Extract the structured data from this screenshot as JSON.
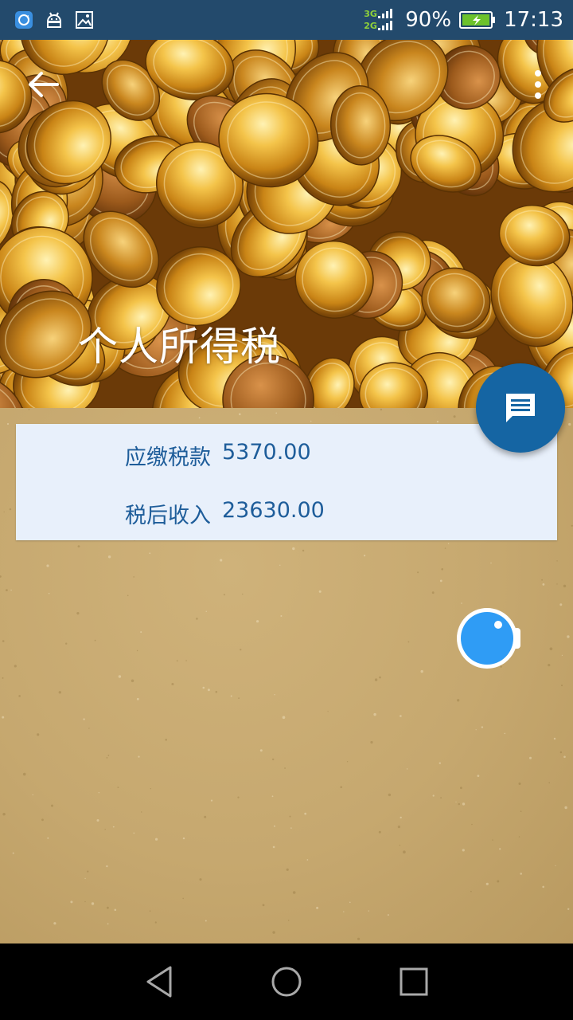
{
  "status_bar": {
    "network_3g": "3G",
    "network_2g": "2G",
    "battery_percent": "90%",
    "time": "17:13"
  },
  "header": {
    "title": "个人所得税"
  },
  "result": {
    "tax_label": "应缴税款",
    "tax_value": "5370.00",
    "after_tax_label": "税后收入",
    "after_tax_value": "23630.00"
  },
  "colors": {
    "status_bar_bg": "#234a6c",
    "fab_bg": "#1565a3",
    "card_bg": "#e8f0fb",
    "result_text": "#1e5d9a"
  },
  "icons": {
    "back": "arrow-left-icon",
    "more": "more-vert-icon",
    "fab": "chat-message-icon",
    "floating": "camera-bubble-icon"
  }
}
